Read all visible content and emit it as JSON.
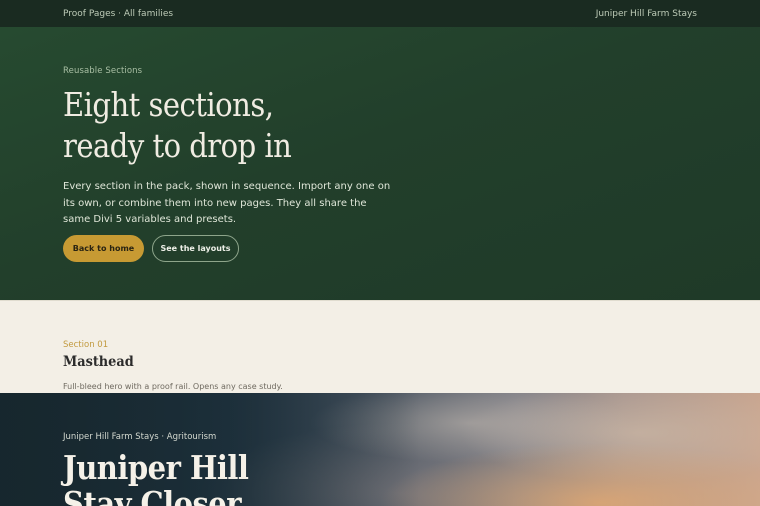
{
  "topbar": {
    "left": "Proof Pages · All families",
    "right": "Juniper Hill Farm Stays"
  },
  "hero": {
    "eyebrow": "Reusable Sections",
    "title_line1": "Eight sections,",
    "title_line2": "ready to drop in",
    "description": "Every section in the pack, shown in sequence. Import any one on its own, or combine them into new pages. They all share the same Divi 5 variables and presets.",
    "primary_button": "Back to home",
    "secondary_button": "See the layouts"
  },
  "section": {
    "label": "Section 01",
    "title": "Masthead",
    "description": "Full-bleed hero with a proof rail. Opens any case study."
  },
  "preview": {
    "eyebrow": "Juniper Hill Farm Stays · Agritourism",
    "title_line1": "Juniper Hill",
    "title_line2": "Stay Closer"
  },
  "colors": {
    "hero_bg": "#234430",
    "accent_gold": "#c79a33",
    "page_bg": "#f3efe6"
  }
}
